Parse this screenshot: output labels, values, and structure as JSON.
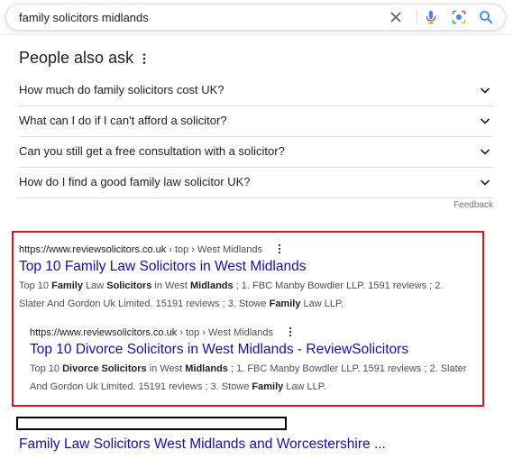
{
  "search": {
    "query": "family solicitors midlands"
  },
  "icons": {
    "clear": "close-icon",
    "voice": "microphone-icon",
    "lens": "camera-icon",
    "search": "search-icon"
  },
  "colors": {
    "link": "#1a0dab",
    "highlight_border": "#e0131b",
    "mic_blue": "#4285f4",
    "mic_red": "#ea4335",
    "mic_yellow": "#fbbc04",
    "mic_green": "#34a853"
  },
  "people_also_ask": {
    "title": "People also ask",
    "questions": [
      {
        "text": "How much do family solicitors cost UK?"
      },
      {
        "text": "What can I do if I can't afford a solicitor?"
      },
      {
        "text": "Can you still get a free consultation with a solicitor?"
      },
      {
        "text": "How do I find a good family law solicitor UK?"
      }
    ],
    "feedback": "Feedback"
  },
  "results": [
    {
      "url": "https://www.reviewsolicitors.co.uk",
      "breadcrumb": " › top › West Midlands",
      "title": "Top 10 Family Law Solicitors in West Midlands",
      "snippet": {
        "p1": "Top 10 ",
        "b1": "Family",
        "p2": " Law ",
        "b2": "Solicitors",
        "p3": " in West ",
        "b3": "Midlands",
        "p4": " ; 1. FBC Manby Bowdler LLP. 1591 reviews ; 2. Slater And Gordon Uk Limited. 15191 reviews ; 3. Stowe ",
        "b4": "Family",
        "p5": " Law LLP."
      }
    },
    {
      "url": "https://www.reviewsolicitors.co.uk",
      "breadcrumb": " › top › West Midlands",
      "title": "Top 10 Divorce Solicitors in West Midlands - ReviewSolicitors",
      "snippet": {
        "p1": "Top 10 ",
        "b1": "Divorce",
        "p2": " ",
        "b2": "Solicitors",
        "p3": " in West ",
        "b3": "Midlands",
        "p4": " ; 1. FBC Manby Bowdler LLP. 1591 reviews ; 2. Slater And Gordon Uk Limited. 15191 reviews ; 3. Stowe ",
        "b4": "Family",
        "p5": " Law LLP."
      }
    },
    {
      "title": "Family Law Solicitors West Midlands and Worcestershire ..."
    }
  ]
}
